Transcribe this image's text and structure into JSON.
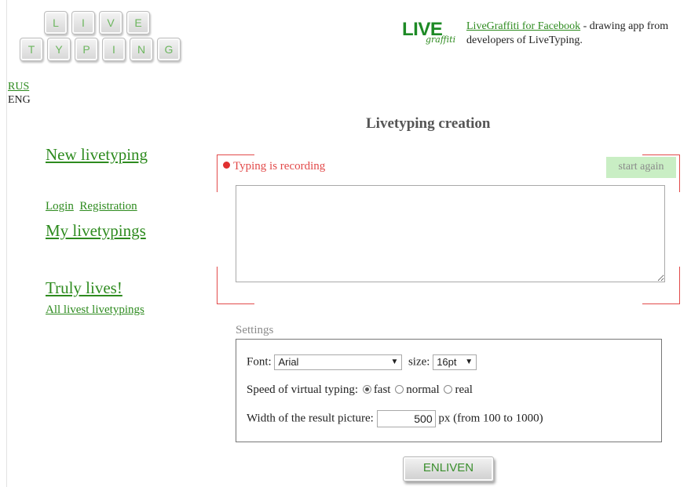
{
  "logo": {
    "row1": [
      "L",
      "I",
      "V",
      "E"
    ],
    "row2": [
      "T",
      "Y",
      "P",
      "I",
      "N",
      "G"
    ]
  },
  "promo": {
    "logo_big": "LIVE",
    "logo_small": "graffiti",
    "link_text": "LiveGraffiti for Facebook",
    "desc": " - drawing app from developers of LiveTyping."
  },
  "lang": {
    "rus": "RUS",
    "eng": "ENG"
  },
  "nav": {
    "new_livetyping": "New livetyping",
    "login": "Login",
    "registration": "Registration",
    "my_livetypings": "My livetypings",
    "truly_lives": "Truly lives!",
    "all_livest": "All livest livetypings"
  },
  "main": {
    "title": "Livetyping creation",
    "recording": "Typing is recording",
    "start_again": "start again",
    "typing_value": ""
  },
  "settings": {
    "label": "Settings",
    "font_label": "Font:",
    "font_value": "Arial",
    "size_label": "size:",
    "size_value": "16pt",
    "speed_label": "Speed of virtual typing:",
    "speed_options": [
      "fast",
      "normal",
      "real"
    ],
    "speed_selected": "fast",
    "width_label": "Width of the result picture:",
    "width_value": "500",
    "width_suffix": "px (from 100 to 1000)"
  },
  "enliven_label": "ENLIVEN",
  "colors": {
    "link": "#2e8b1f",
    "recording": "#e24a4a",
    "start_again_bg": "#c9eec4"
  }
}
